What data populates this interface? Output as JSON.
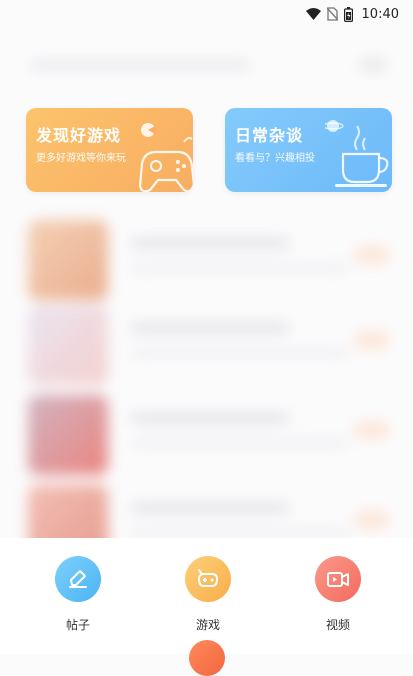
{
  "status_bar": {
    "time": "10:40",
    "icons": [
      "wifi-icon",
      "no-sim-icon",
      "battery-icon"
    ]
  },
  "cards": {
    "game": {
      "title": "发现好游戏",
      "subtitle": "更多好游戏等你来玩",
      "colors": [
        "#fcc36c",
        "#f8ad62"
      ]
    },
    "talk": {
      "title": "日常杂谈",
      "subtitle": "看看与？兴趣相投",
      "colors": [
        "#84cbfb",
        "#6db9fa"
      ]
    }
  },
  "actions": {
    "post": {
      "label": "帖子",
      "icon": "pencil-icon",
      "color": "#4bb4f4"
    },
    "game": {
      "label": "游戏",
      "icon": "gamepad-icon",
      "color": "#f8ad47"
    },
    "video": {
      "label": "视频",
      "icon": "video-camera-icon",
      "color": "#f26a5d"
    }
  },
  "close_button": {
    "icon": "close-icon",
    "color": "#f2663f"
  }
}
